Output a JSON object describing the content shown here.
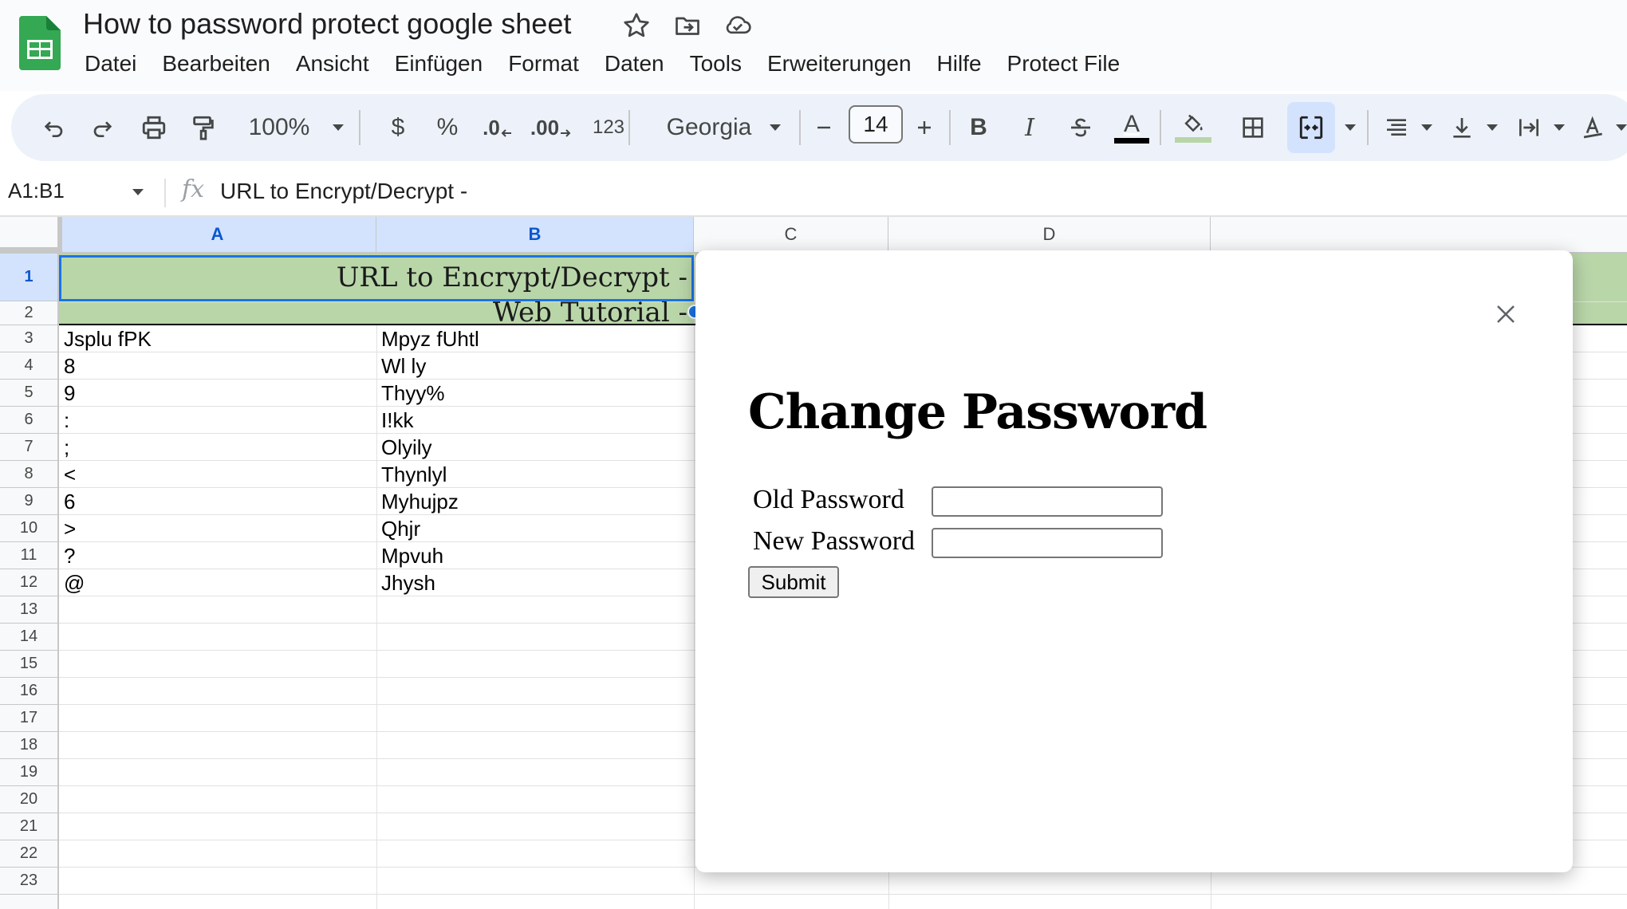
{
  "app": {
    "document_title": "How to password protect google sheet",
    "menu": [
      "Datei",
      "Bearbeiten",
      "Ansicht",
      "Einfügen",
      "Format",
      "Daten",
      "Tools",
      "Erweiterungen",
      "Hilfe",
      "Protect File"
    ]
  },
  "toolbar": {
    "zoom": "100%",
    "currency": "$",
    "percent": "%",
    "decrease_decimal": ".0",
    "increase_decimal": ".00",
    "number_format": "123",
    "font": "Georgia",
    "font_size": "14",
    "bold": "B",
    "italic": "I",
    "text_color_letter": "A",
    "text_color": "#000000",
    "fill_color": "#b9d6a9"
  },
  "formula_bar": {
    "name_box": "A1:B1",
    "fx": "fx",
    "formula": "URL to Encrypt/Decrypt -"
  },
  "sheet": {
    "columns": [
      "A",
      "B",
      "C",
      "D"
    ],
    "selected_columns": [
      "A",
      "B"
    ],
    "row_numbers": [
      "1",
      "2",
      "3",
      "4",
      "5",
      "6",
      "7",
      "8",
      "9",
      "10",
      "11",
      "12",
      "13",
      "14",
      "15",
      "16",
      "17",
      "18",
      "19",
      "20",
      "21",
      "22",
      "23"
    ],
    "selected_row": "1",
    "merged_row1": "URL to Encrypt/Decrypt -",
    "merged_row2": "Web Tutorial -",
    "rows": [
      {
        "a": "Jsplu fPK",
        "b": "Mpyz fUhtl"
      },
      {
        "a": "8",
        "b": "Wl ly"
      },
      {
        "a": "9",
        "b": "Thyy%"
      },
      {
        "a": ":",
        "b": "I!kk"
      },
      {
        "a": ";",
        "b": "Olyily"
      },
      {
        "a": "<",
        "b": "Thynlyl"
      },
      {
        "a": "6",
        "b": "Myhujpz"
      },
      {
        "a": ">",
        "b": "Qhjr"
      },
      {
        "a": "?",
        "b": "Mpvuh"
      },
      {
        "a": "@",
        "b": "Jhysh"
      }
    ],
    "header_fill": "#b9d6a9",
    "selection_color": "#1a73e8"
  },
  "dialog": {
    "title": "Change Password",
    "old_password_label": "Old Password",
    "new_password_label": "New Password",
    "old_password_value": "",
    "new_password_value": "",
    "submit_label": "Submit"
  }
}
